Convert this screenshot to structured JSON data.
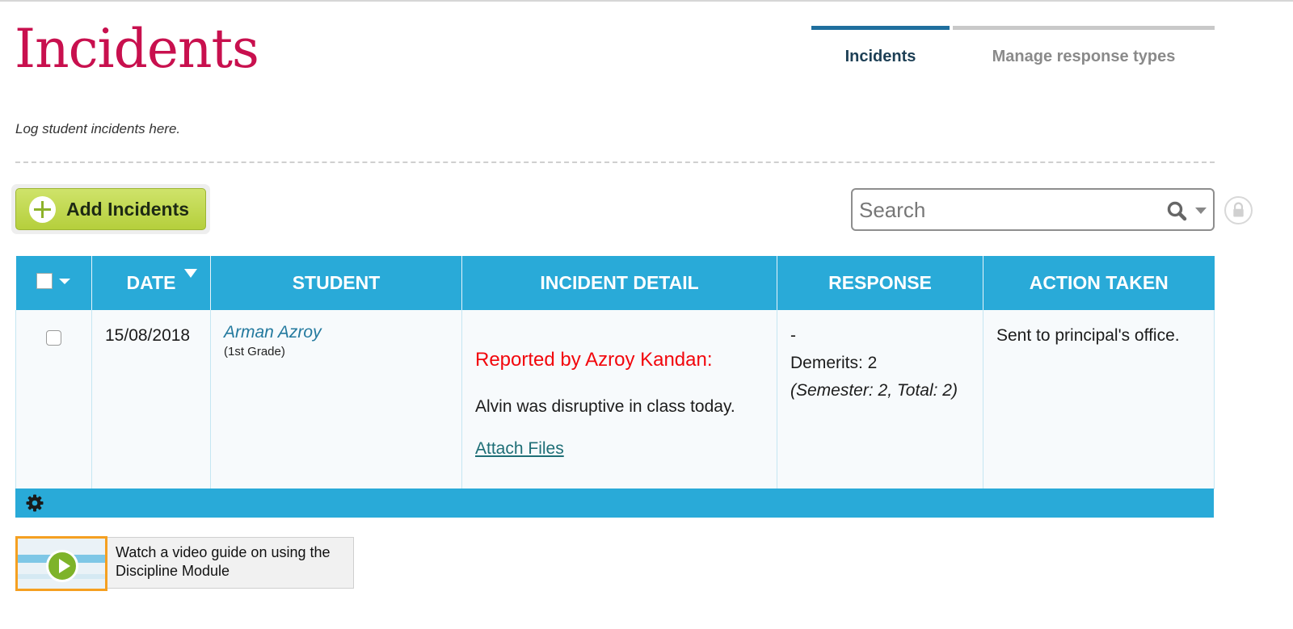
{
  "page": {
    "title": "Incidents",
    "subtitle": "Log student incidents here."
  },
  "tabs": [
    {
      "label": "Incidents",
      "active": true
    },
    {
      "label": "Manage response types",
      "active": false
    }
  ],
  "toolbar": {
    "add_label": "Add Incidents",
    "search_placeholder": "Search"
  },
  "table": {
    "headers": [
      "DATE",
      "STUDENT",
      "INCIDENT DETAIL",
      "RESPONSE",
      "ACTION TAKEN"
    ],
    "rows": [
      {
        "date": "15/08/2018",
        "student_name": "Arman Azroy",
        "student_grade": "(1st Grade)",
        "reported_by": "Reported by Azroy Kandan:",
        "detail": "Alvin was disruptive in class today.",
        "attach_label": "Attach Files",
        "response_dash": "-",
        "response_demerits": "Demerits: 2",
        "response_totals": "(Semester: 2, Total: 2)",
        "action_taken": "Sent to principal's office."
      }
    ]
  },
  "video_guide": {
    "text": "Watch a video guide on using the Discipline Module"
  },
  "colors": {
    "title": "#c8104e",
    "table_header": "#29aad8",
    "add_button": "#b5cf3c",
    "reported_by": "#f2060c",
    "active_tab": "#1f6f9e",
    "video_border": "#f5a021"
  },
  "icons": [
    "plus-icon",
    "search-icon",
    "chevron-down-icon",
    "lock-icon",
    "sort-desc-icon",
    "gear-icon",
    "play-icon"
  ]
}
